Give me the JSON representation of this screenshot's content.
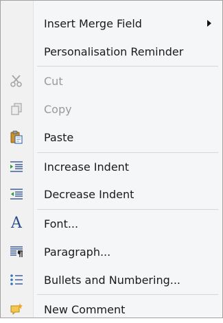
{
  "menu": {
    "items": [
      {
        "label": "Insert Merge Field",
        "icon": "none",
        "submenu": true
      },
      {
        "label": "Personalisation Reminder",
        "icon": "none"
      },
      {
        "label": "Cut",
        "icon": "scissors-icon",
        "disabled": true
      },
      {
        "label": "Copy",
        "icon": "copy-icon",
        "disabled": true
      },
      {
        "label": "Paste",
        "icon": "paste-icon"
      },
      {
        "label": "Increase Indent",
        "icon": "increase-indent-icon"
      },
      {
        "label": "Decrease Indent",
        "icon": "decrease-indent-icon"
      },
      {
        "label": "Font...",
        "icon": "font-icon",
        "icon_glyph": "A"
      },
      {
        "label": "Paragraph...",
        "icon": "paragraph-icon"
      },
      {
        "label": "Bullets and Numbering...",
        "icon": "bullets-icon"
      },
      {
        "label": "New Comment",
        "icon": "new-comment-icon"
      }
    ]
  },
  "colors": {
    "menu_bg": "#f5f6f7",
    "gutter_bg": "#f1f1f1",
    "text": "#1a1a1a",
    "disabled_text": "#9a9a9a",
    "separator": "#d6d6d6",
    "icon_blue": "#2a4a8a"
  }
}
